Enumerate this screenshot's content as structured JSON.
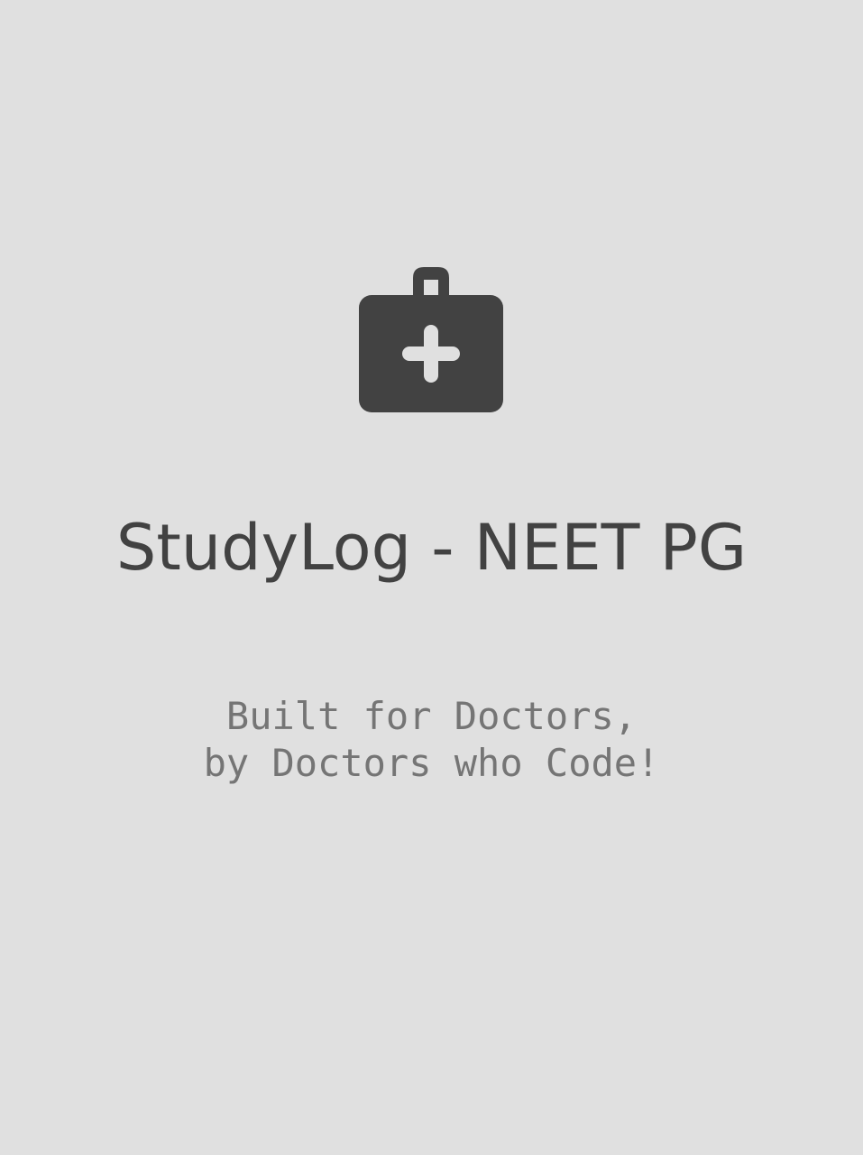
{
  "splash": {
    "logo_icon": "medical-bag-icon",
    "title": "StudyLog - NEET PG",
    "tagline_line1": "Built for Doctors,",
    "tagline_line2": "by Doctors who Code!"
  },
  "colors": {
    "background": "#e0e0e0",
    "icon": "#424242",
    "title": "#424242",
    "tagline": "#757575"
  }
}
